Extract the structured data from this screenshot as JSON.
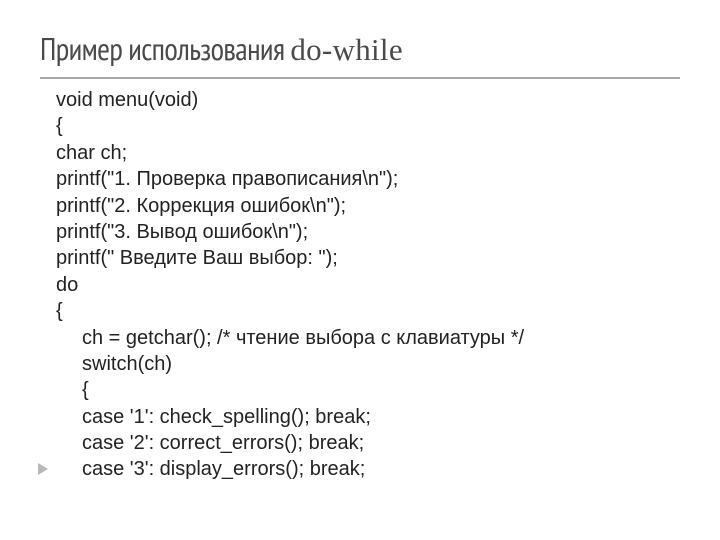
{
  "title_part1": "Пример использования ",
  "title_part2": "do-while",
  "code": {
    "l1": "void menu(void)",
    "l2": "{",
    "l3": "char ch;",
    "l4": "printf(\"1. Проверка правописания\\n\");",
    "l5": "printf(\"2. Коррекция ошибок\\n\");",
    "l6": "printf(\"3. Вывод ошибок\\n\");",
    "l7": "printf(\" Введите Ваш выбор: \");",
    "l8": "do",
    "l9": "{",
    "l10": "ch = getchar(); /* чтение выбора с клавиатуры */",
    "l11": "switch(ch)",
    "l12": "{",
    "l13": "case '1': check_spelling(); break;",
    "l14": "case '2': correct_errors(); break;",
    "l15": "case '3': display_errors(); break;"
  }
}
